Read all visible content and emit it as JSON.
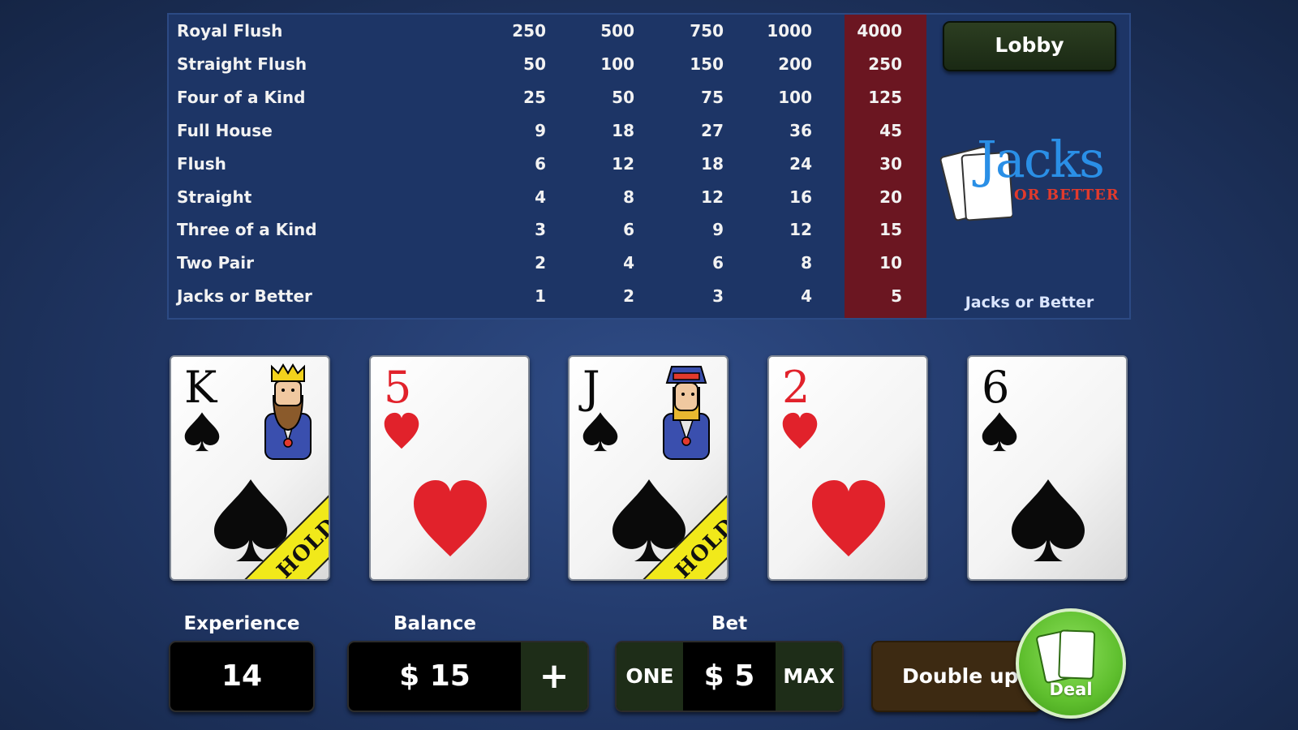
{
  "paytable": {
    "rows": [
      {
        "hand": "Royal Flush",
        "payouts": [
          "250",
          "500",
          "750",
          "1000",
          "4000"
        ]
      },
      {
        "hand": "Straight Flush",
        "payouts": [
          "50",
          "100",
          "150",
          "200",
          "250"
        ]
      },
      {
        "hand": "Four of a Kind",
        "payouts": [
          "25",
          "50",
          "75",
          "100",
          "125"
        ]
      },
      {
        "hand": "Full House",
        "payouts": [
          "9",
          "18",
          "27",
          "36",
          "45"
        ]
      },
      {
        "hand": "Flush",
        "payouts": [
          "6",
          "12",
          "18",
          "24",
          "30"
        ]
      },
      {
        "hand": "Straight",
        "payouts": [
          "4",
          "8",
          "12",
          "16",
          "20"
        ]
      },
      {
        "hand": "Three of a Kind",
        "payouts": [
          "3",
          "6",
          "9",
          "12",
          "15"
        ]
      },
      {
        "hand": "Two Pair",
        "payouts": [
          "2",
          "4",
          "6",
          "8",
          "10"
        ]
      },
      {
        "hand": "Jacks or Better",
        "payouts": [
          "1",
          "2",
          "3",
          "4",
          "5"
        ]
      }
    ],
    "highlight_color": "#6b1621",
    "lobby_label": "Lobby",
    "logo_word": "Jacks",
    "logo_sub": "OR BETTER",
    "caption": "Jacks or Better"
  },
  "cards": [
    {
      "rank": "K",
      "suit": "spade",
      "color": "black",
      "held": true,
      "face": "king"
    },
    {
      "rank": "5",
      "suit": "heart",
      "color": "red",
      "held": false,
      "face": null
    },
    {
      "rank": "J",
      "suit": "spade",
      "color": "black",
      "held": true,
      "face": "jack"
    },
    {
      "rank": "2",
      "suit": "heart",
      "color": "red",
      "held": false,
      "face": null
    },
    {
      "rank": "6",
      "suit": "spade",
      "color": "black",
      "held": false,
      "face": null
    }
  ],
  "hold_label": "HOLD",
  "experience": {
    "label": "Experience",
    "value": "14"
  },
  "balance": {
    "label": "Balance",
    "value": "$ 15",
    "add_label": "+"
  },
  "bet": {
    "label": "Bet",
    "one_label": "ONE",
    "value": "$ 5",
    "max_label": "MAX"
  },
  "double_up_label": "Double up",
  "deal_label": "Deal",
  "colors": {
    "accent_green": "#5fbf2e",
    "hold_yellow": "#f1e91a",
    "card_red": "#e1222b"
  }
}
